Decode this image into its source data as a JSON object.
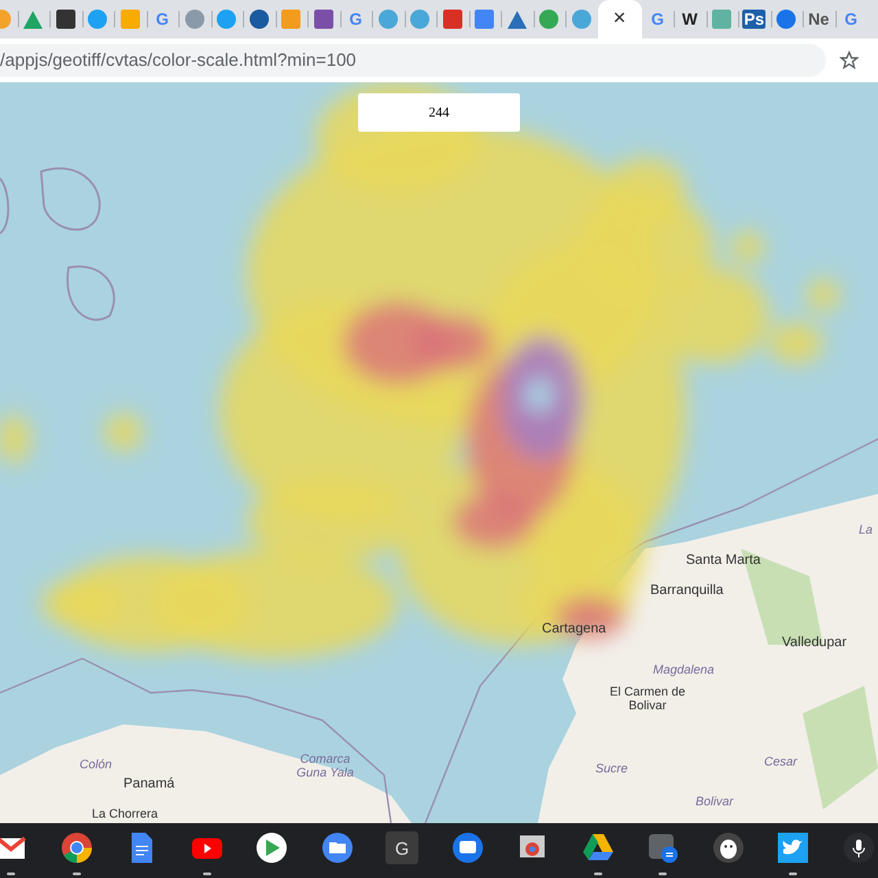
{
  "tabs": [
    {
      "kind": "circle",
      "color": "#f4a32a",
      "selected": false
    },
    {
      "kind": "triangle",
      "color": "#1fa463",
      "selected": false
    },
    {
      "kind": "square",
      "color": "#333333",
      "selected": false
    },
    {
      "kind": "circle",
      "color": "#1da1f2",
      "selected": false
    },
    {
      "kind": "square",
      "color": "#f9ab00",
      "selected": false
    },
    {
      "kind": "letter",
      "text": "G",
      "color": "#4285f4",
      "selected": false
    },
    {
      "kind": "circle",
      "color": "#8a9aa8",
      "selected": false
    },
    {
      "kind": "circle",
      "color": "#1da1f2",
      "selected": false
    },
    {
      "kind": "circle",
      "color": "#1a5aa0",
      "selected": false
    },
    {
      "kind": "square",
      "color": "#f29b1d",
      "selected": false
    },
    {
      "kind": "square",
      "color": "#7b4fa8",
      "selected": false
    },
    {
      "kind": "letter",
      "text": "G",
      "color": "#4285f4",
      "selected": false
    },
    {
      "kind": "circle",
      "color": "#4aa8d8",
      "selected": false
    },
    {
      "kind": "circle",
      "color": "#4aa8d8",
      "selected": false
    },
    {
      "kind": "square",
      "color": "#d93025",
      "selected": false
    },
    {
      "kind": "square",
      "color": "#4285f4",
      "selected": false
    },
    {
      "kind": "triangle",
      "color": "#2a6fb8",
      "selected": false
    },
    {
      "kind": "circle",
      "color": "#34a853",
      "selected": false
    },
    {
      "kind": "circle",
      "color": "#4aa8d8",
      "selected": false
    },
    {
      "kind": "close",
      "text": "×",
      "selected": true
    },
    {
      "kind": "letter",
      "text": "G",
      "color": "#4285f4",
      "selected": false
    },
    {
      "kind": "letter",
      "text": "W",
      "color": "#222222",
      "selected": false
    },
    {
      "kind": "square",
      "color": "#5fb3a0",
      "selected": false
    },
    {
      "kind": "badge",
      "text": "Ps",
      "color": "#1d5fa8",
      "selected": false
    },
    {
      "kind": "circle",
      "color": "#1a73e8",
      "selected": false
    },
    {
      "kind": "letter",
      "text": "Ne",
      "color": "#555555",
      "selected": false
    },
    {
      "kind": "letter",
      "text": "G",
      "color": "#4285f4",
      "selected": false
    }
  ],
  "address_bar": {
    "url": "/appjs/geotiff/cvtas/color-scale.html?min=100"
  },
  "map": {
    "value_box": "244",
    "labels": [
      {
        "text": "Santa Marta",
        "kind": "city"
      },
      {
        "text": "Barranquilla",
        "kind": "city"
      },
      {
        "text": "Cartagena",
        "kind": "city"
      },
      {
        "text": "Valledupar",
        "kind": "city"
      },
      {
        "text": "Magdalena",
        "kind": "region"
      },
      {
        "text": "El Carmen de Bolivar",
        "kind": "town"
      },
      {
        "text": "Sucre",
        "kind": "region"
      },
      {
        "text": "Cesar",
        "kind": "region"
      },
      {
        "text": "Bolivar",
        "kind": "region"
      },
      {
        "text": "La",
        "kind": "region"
      },
      {
        "text": "Colón",
        "kind": "region"
      },
      {
        "text": "Panamá",
        "kind": "city"
      },
      {
        "text": "La Chorrera",
        "kind": "town"
      },
      {
        "text": "Comarca Guna Yala",
        "kind": "region"
      }
    ]
  },
  "shelf": [
    {
      "kind": "gmail",
      "open": true
    },
    {
      "kind": "chrome",
      "open": true
    },
    {
      "kind": "docs",
      "open": false
    },
    {
      "kind": "youtube",
      "open": true
    },
    {
      "kind": "play",
      "open": false
    },
    {
      "kind": "files",
      "open": false
    },
    {
      "kind": "letter",
      "text": "G",
      "open": false
    },
    {
      "kind": "messages",
      "open": false
    },
    {
      "kind": "chrome-app",
      "open": false
    },
    {
      "kind": "drive",
      "open": true
    },
    {
      "kind": "calculator",
      "open": true
    },
    {
      "kind": "penguin",
      "open": false
    },
    {
      "kind": "twitter",
      "open": true
    },
    {
      "kind": "mic",
      "open": false
    }
  ]
}
